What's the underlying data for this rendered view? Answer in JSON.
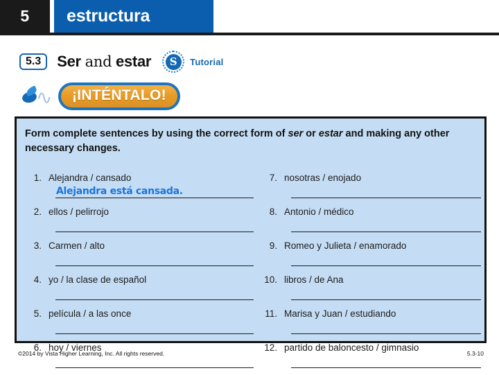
{
  "header": {
    "chapter_number": "5",
    "section_name": "estructura"
  },
  "lesson": {
    "number_badge": "5.3",
    "title_part1": "Ser",
    "title_joiner": "and",
    "title_part2": "estar",
    "tutorial_icon_letter": "S",
    "tutorial_label": "Tutorial"
  },
  "banner": {
    "label": "¡INTÉNTALO!"
  },
  "activity": {
    "instructions_part1": "Form complete sentences by using the correct form of ",
    "instructions_italic1": "ser",
    "instructions_part2": " or ",
    "instructions_italic2": "estar",
    "instructions_part3": " and making any other necessary changes.",
    "left_items": [
      {
        "num": "1.",
        "cue": "Alejandra / cansado",
        "answer": "Alejandra está cansada."
      },
      {
        "num": "2.",
        "cue": "ellos / pelirrojo",
        "answer": ""
      },
      {
        "num": "3.",
        "cue": "Carmen / alto",
        "answer": ""
      },
      {
        "num": "4.",
        "cue": "yo / la clase de español",
        "answer": ""
      },
      {
        "num": "5.",
        "cue": "película / a las once",
        "answer": ""
      },
      {
        "num": "6.",
        "cue": "hoy / viernes",
        "answer": ""
      }
    ],
    "right_items": [
      {
        "num": "7.",
        "cue": "nosotras / enojado",
        "answer": ""
      },
      {
        "num": "8.",
        "cue": "Antonio / médico",
        "answer": ""
      },
      {
        "num": "9.",
        "cue": "Romeo y Julieta / enamorado",
        "answer": ""
      },
      {
        "num": "10.",
        "cue": "libros / de Ana",
        "answer": ""
      },
      {
        "num": "11.",
        "cue": "Marisa y Juan / estudiando",
        "answer": ""
      },
      {
        "num": "12.",
        "cue": "partido de baloncesto / gimnasio",
        "answer": ""
      }
    ]
  },
  "footer": {
    "copyright": "©2014 by Vista Higher Learning, Inc. All rights reserved.",
    "page_ref": "5.3-10"
  },
  "colors": {
    "brand_blue": "#0b5eae",
    "panel_fill": "#c5ddf4",
    "answer_blue": "#1a74d8",
    "banner_gold": "#e89a22",
    "header_black": "#1a1a1a"
  }
}
